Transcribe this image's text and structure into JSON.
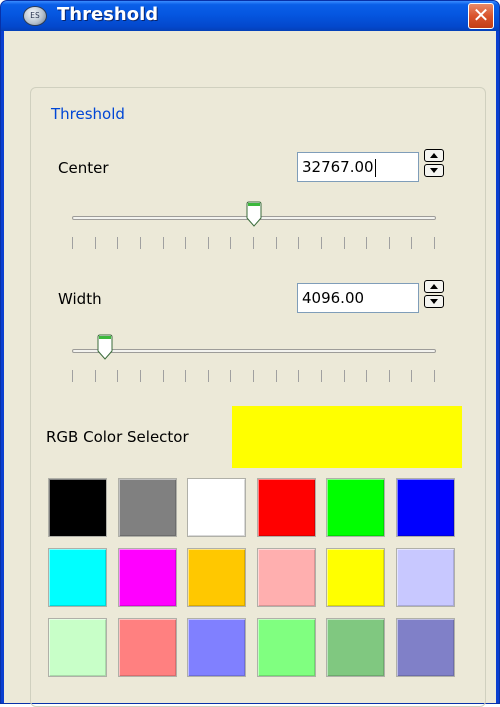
{
  "window": {
    "title": "Threshold",
    "app_icon_text": "ES",
    "close_glyph": "✕"
  },
  "group": {
    "title": "Threshold"
  },
  "center": {
    "label": "Center",
    "value": "32767.00",
    "slider_fraction": 0.5
  },
  "width": {
    "label": "Width",
    "value": "4096.00",
    "slider_fraction": 0.0625
  },
  "rgb": {
    "label": "RGB Color Selector",
    "selected_color": "#ffff00"
  },
  "palette": [
    [
      "#000000",
      "#808080",
      "#ffffff",
      "#ff0000",
      "#00ff00",
      "#0000ff"
    ],
    [
      "#00ffff",
      "#ff00ff",
      "#ffc800",
      "#ffafaf",
      "#ffff00",
      "#c8c8ff"
    ],
    [
      "#c8ffc8",
      "#ff8080",
      "#8080ff",
      "#80ff80",
      "#80c880",
      "#8080c8"
    ]
  ],
  "colors": {
    "titlebar": "#0556e0",
    "window_bg": "#ece9d8",
    "group_title": "#0046d5",
    "close_button": "#d9542c",
    "slider_thumb_accent": "#3cb83c"
  },
  "icons": {
    "app": "app-icon",
    "close": "close-icon",
    "spinner_up": "spinner-up-icon",
    "spinner_down": "spinner-down-icon"
  }
}
